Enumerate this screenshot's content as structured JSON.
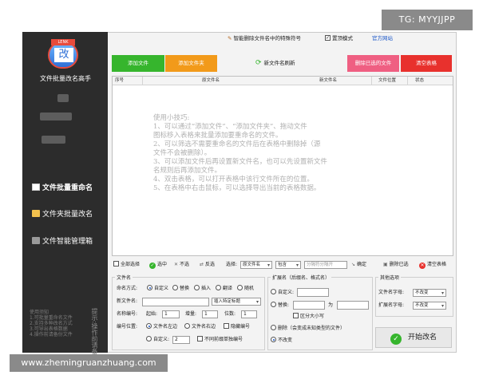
{
  "watermark": {
    "top": "TG: MYYJJPP",
    "bottom": "www.zhemingruanzhuang.com"
  },
  "sidebar": {
    "logo_glyph": "改",
    "logo_tag": "LENK",
    "title": "文件批量改名高手",
    "items": [
      {
        "label": "文件批量重命名",
        "icon": "document-icon"
      },
      {
        "label": "文件夹批量改名",
        "icon": "folder-icon"
      },
      {
        "label": "文件智能管理箱",
        "icon": "toolbox-icon"
      }
    ],
    "footer_lines": [
      "使用须知",
      "1.可批量重命名文件",
      "2.支持多种改名方式",
      "3.可导出表格数据",
      "4.操作前请备份文件"
    ],
    "vertical_text": "提示:操作前请备份"
  },
  "topbar": {
    "smart_remove": "智能删除文件名中的特殊符号",
    "topmost": "置顶模式",
    "official_site": "官方网站"
  },
  "actions": {
    "add_file": "添加文件",
    "add_folder": "添加文件夹",
    "new_name_refresh": "新文件名刷新",
    "remove_selected": "删除已选的文件",
    "clear_table": "清空表格"
  },
  "table": {
    "columns": [
      "序号",
      "原文件名",
      "新文件名",
      "文件位置",
      "状态"
    ],
    "tips": [
      "使用小技巧:",
      "1、可以通过“添加文件”、“添加文件夹”、拖动文件",
      "图标移入表格来批量添加要重命名的文件。",
      "2、可以筛选不需要重命名的文件后在表格中删除掉（源",
      "文件不会被删除）。",
      "3、可以添加文件后再设置新文件名，也可以先设置新文件",
      "名规则后再添加文件。",
      "4、双击表格，可以打开表格中该行文件所在的位置。",
      "5、在表格中右击鼠标，可以选择导出当前的表格数据。"
    ]
  },
  "selection_bar": {
    "select_all": "全部选择",
    "select": "选中",
    "deselect": "不选",
    "invert": "反选",
    "filter_label": "选择:",
    "filter_field": "原文件名",
    "filter_mode": "包含",
    "filter_placeholder": "分隔符分隔开",
    "confirm": "确定",
    "delete_selected": "删除已选",
    "clear_table": "清空表格"
  },
  "filename_panel": {
    "title": "文件名",
    "mode_label": "命名方式:",
    "modes": [
      "自定义",
      "替换",
      "插入",
      "翻译",
      "随机"
    ],
    "selected_mode": "自定义",
    "new_name_label": "新文件名:",
    "insert_label": "插入特定标题",
    "number_label": "名称编号:",
    "start_label": "起始:",
    "start_value": "1",
    "step_label": "增量:",
    "step_value": "1",
    "digits_label": "位数:",
    "digits_value": "1",
    "position_label": "编号位置:",
    "position_left": "文件名左边",
    "position_right": "文件名右边",
    "hide_number": "隐藏编号",
    "custom_label": "自定义:",
    "custom_value": "2",
    "no_pad": "不同前缀单独编号"
  },
  "ext_panel": {
    "title": "扩展名（后缀名、格式名）",
    "custom": "自定义:",
    "replace": "替换:",
    "to": "为",
    "case_sensitive": "区分大小写",
    "delete": "删除（会变成未知类型的文件）",
    "unchanged": "不改变",
    "selected": "不改变"
  },
  "other_panel": {
    "title": "其他选项",
    "name_case_label": "文件名字母:",
    "name_case_value": "不改变",
    "ext_case_label": "扩展名字母:",
    "ext_case_value": "不改变"
  },
  "start_button": "开始改名",
  "colors": {
    "sidebar_bg": "#2c2c2c",
    "add_file": "#36b52d",
    "add_folder": "#f29a1a",
    "remove_selected": "#ef5f82",
    "clear_table": "#e8312d",
    "link_blue": "#1b57c8"
  }
}
